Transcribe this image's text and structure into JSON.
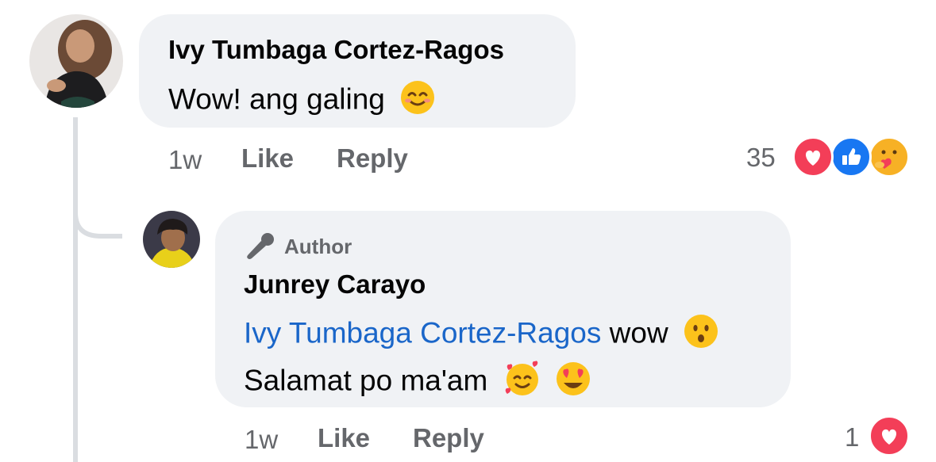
{
  "comment": {
    "author": "Ivy Tumbaga Cortez-Ragos",
    "text": "Wow! ang galing",
    "time": "1w",
    "like_label": "Like",
    "reply_label": "Reply",
    "reaction_count": "35",
    "reactions": [
      "love-icon",
      "like-icon",
      "care-icon"
    ],
    "emoji": "smiling-face-icon"
  },
  "reply": {
    "badge": "Author",
    "badge_icon": "microphone-icon",
    "author": "Junrey Carayo",
    "mention": "Ivy Tumbaga Cortez-Ragos",
    "text_after_mention": "wow",
    "second_line": "Salamat po ma'am",
    "time": "1w",
    "like_label": "Like",
    "reply_label": "Reply",
    "reaction_count": "1",
    "reactions": [
      "love-icon"
    ],
    "emojis": [
      "hushed-face-icon",
      "smiling-face-with-hearts-icon",
      "heart-eyes-icon"
    ]
  },
  "colors": {
    "bubble": "#f0f2f5",
    "mention": "#1a66c9",
    "meta": "#65676b",
    "love": "#f33e58",
    "like": "#1877f2"
  }
}
